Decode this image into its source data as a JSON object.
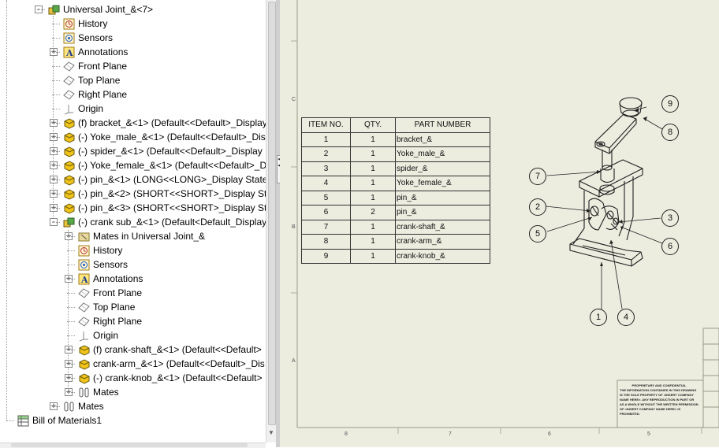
{
  "tree": {
    "items": [
      {
        "label": "Universal Joint_&<7>",
        "icon": "assembly-icon",
        "exp": "-"
      },
      {
        "label": "History",
        "icon": "history-icon"
      },
      {
        "label": "Sensors",
        "icon": "sensors-icon"
      },
      {
        "label": "Annotations",
        "icon": "annotations-icon",
        "exp": "+"
      },
      {
        "label": "Front Plane",
        "icon": "plane-icon"
      },
      {
        "label": "Top Plane",
        "icon": "plane-icon"
      },
      {
        "label": "Right Plane",
        "icon": "plane-icon"
      },
      {
        "label": "Origin",
        "icon": "origin-icon"
      },
      {
        "label": "(f) bracket_&<1> (Default<<Default>_Display",
        "icon": "part-icon",
        "exp": "+"
      },
      {
        "label": "(-) Yoke_male_&<1> (Default<<Default>_Dis",
        "icon": "part-icon",
        "exp": "+"
      },
      {
        "label": "(-) spider_&<1> (Default<<Default>_Display",
        "icon": "part-icon",
        "exp": "+"
      },
      {
        "label": "(-) Yoke_female_&<1> (Default<<Default>_D",
        "icon": "part-icon",
        "exp": "+"
      },
      {
        "label": "(-) pin_&<1> (LONG<<LONG>_Display State",
        "icon": "part-icon",
        "exp": "+"
      },
      {
        "label": "(-) pin_&<2> (SHORT<<SHORT>_Display Sta",
        "icon": "part-icon",
        "exp": "+"
      },
      {
        "label": "(-) pin_&<3> (SHORT<<SHORT>_Display Sta",
        "icon": "part-icon",
        "exp": "+"
      },
      {
        "label": "(-) crank sub_&<1> (Default<Default_Display",
        "icon": "subassembly-icon",
        "exp": "-"
      },
      {
        "label": "Mates in Universal Joint_&",
        "icon": "mates-folder-icon",
        "exp": "+"
      },
      {
        "label": "History",
        "icon": "history-icon"
      },
      {
        "label": "Sensors",
        "icon": "sensors-icon"
      },
      {
        "label": "Annotations",
        "icon": "annotations-icon",
        "exp": "+"
      },
      {
        "label": "Front Plane",
        "icon": "plane-icon"
      },
      {
        "label": "Top Plane",
        "icon": "plane-icon"
      },
      {
        "label": "Right Plane",
        "icon": "plane-icon"
      },
      {
        "label": "Origin",
        "icon": "origin-icon"
      },
      {
        "label": "(f) crank-shaft_&<1> (Default<<Default>",
        "icon": "part-icon",
        "exp": "+"
      },
      {
        "label": "crank-arm_&<1> (Default<<Default>_Dis",
        "icon": "part-icon",
        "exp": "+"
      },
      {
        "label": "(-) crank-knob_&<1> (Default<<Default>",
        "icon": "part-icon",
        "exp": "+"
      },
      {
        "label": "Mates",
        "icon": "mates-icon",
        "exp": "+"
      },
      {
        "label": "Mates",
        "icon": "mates-icon",
        "exp": "+"
      },
      {
        "label": "Bill of Materials1",
        "icon": "bom-icon"
      }
    ]
  },
  "bom": {
    "headers": [
      "ITEM NO.",
      "QTY.",
      "PART NUMBER"
    ],
    "rows": [
      [
        "1",
        "1",
        "bracket_&"
      ],
      [
        "2",
        "1",
        "Yoke_male_&"
      ],
      [
        "3",
        "1",
        "spider_&"
      ],
      [
        "4",
        "1",
        "Yoke_female_&"
      ],
      [
        "5",
        "1",
        "pin_&"
      ],
      [
        "6",
        "2",
        "pin_&"
      ],
      [
        "7",
        "1",
        "crank-shaft_&"
      ],
      [
        "8",
        "1",
        "crank-arm_&"
      ],
      [
        "9",
        "1",
        "crank-knob_&"
      ]
    ]
  },
  "balloons": [
    "9",
    "8",
    "7",
    "2",
    "5",
    "3",
    "6",
    "1",
    "4"
  ],
  "zones": {
    "rows": [
      "C",
      "B",
      "A"
    ],
    "cols": [
      "8",
      "7",
      "6",
      "5"
    ]
  },
  "confidential": {
    "title": "PROPRIETARY AND CONFIDENTIAL",
    "body": "THE INFORMATION CONTAINED IN THIS DRAWING IS THE SOLE PROPERTY OF <INSERT COMPANY NAME HERE>. ANY REPRODUCTION IN PART OR AS A WHOLE WITHOUT THE WRITTEN PERMISSION OF <INSERT COMPANY NAME HERE> IS PROHIBITED."
  },
  "colors": {
    "sheet": "#ececdf",
    "tree_bg": "#ffffff",
    "line": "#222222"
  }
}
